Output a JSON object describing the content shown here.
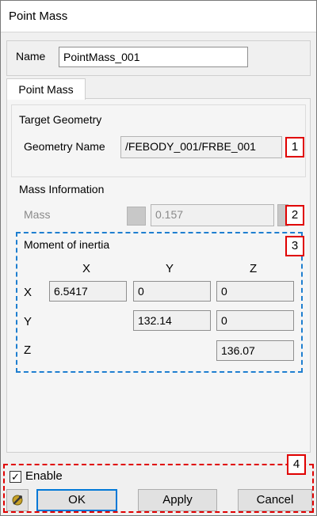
{
  "window": {
    "title": "Point Mass"
  },
  "name_row": {
    "label": "Name",
    "value": "PointMass_001"
  },
  "tab": {
    "label": "Point Mass"
  },
  "target_geometry": {
    "header": "Target Geometry",
    "label": "Geometry Name",
    "value": "/FEBODY_001/FRBE_001",
    "callout": "1"
  },
  "mass_info": {
    "header": "Mass Information",
    "label": "Mass",
    "value": "0.157",
    "callout": "2"
  },
  "inertia": {
    "header": "Moment of inertia",
    "callout": "3",
    "col_x": "X",
    "col_y": "Y",
    "col_z": "Z",
    "row_x": "X",
    "row_y": "Y",
    "row_z": "Z",
    "xx": "6.5417",
    "xy": "0",
    "xz": "0",
    "yy": "132.14",
    "yz": "0",
    "zz": "136.07"
  },
  "footer": {
    "callout": "4",
    "enable_label": "Enable",
    "enable_checked": "✓",
    "ok_label": "OK",
    "apply_label": "Apply",
    "cancel_label": "Cancel"
  }
}
